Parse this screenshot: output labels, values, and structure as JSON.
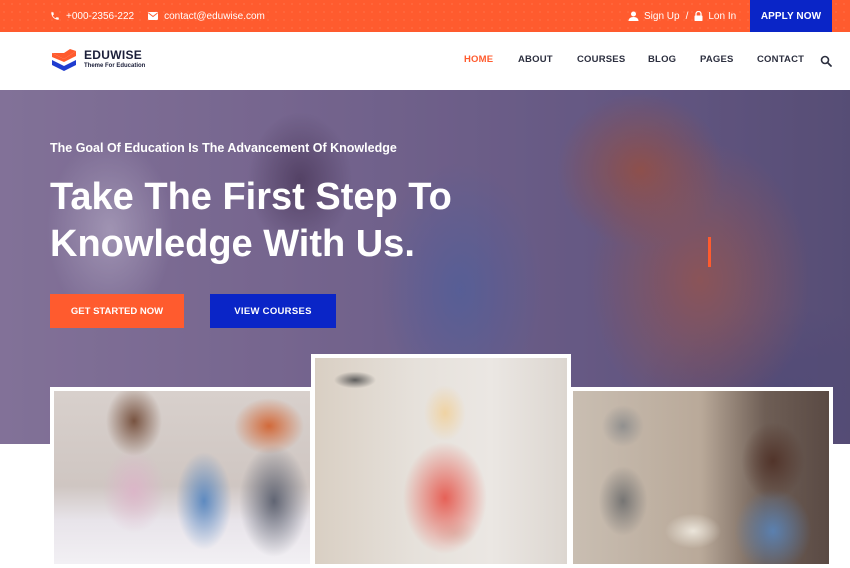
{
  "topbar": {
    "phone": "+000-2356-222",
    "email": "contact@eduwise.com",
    "sign_up": "Sign Up",
    "separator": "/",
    "log_in": "Lon In",
    "apply_button": "APPLY NOW"
  },
  "logo": {
    "title": "EDUWISE",
    "subtitle": "Theme For Education"
  },
  "nav": {
    "items": [
      {
        "label": "HOME",
        "active": true
      },
      {
        "label": "ABOUT",
        "active": false
      },
      {
        "label": "COURSES",
        "active": false
      },
      {
        "label": "BLOG",
        "active": false
      },
      {
        "label": "PAGES",
        "active": false
      },
      {
        "label": "CONTACT",
        "active": false
      }
    ]
  },
  "hero": {
    "tagline": "The Goal Of Education Is The Advancement Of Knowledge",
    "title": "Take The First Step To Knowledge With Us.",
    "primary_button": "GET STARTED NOW",
    "secondary_button": "VIEW COURSES"
  },
  "colors": {
    "accent": "#ff5b2e",
    "brand_blue": "#0a25c7",
    "text_dark": "#2c2f3f"
  }
}
